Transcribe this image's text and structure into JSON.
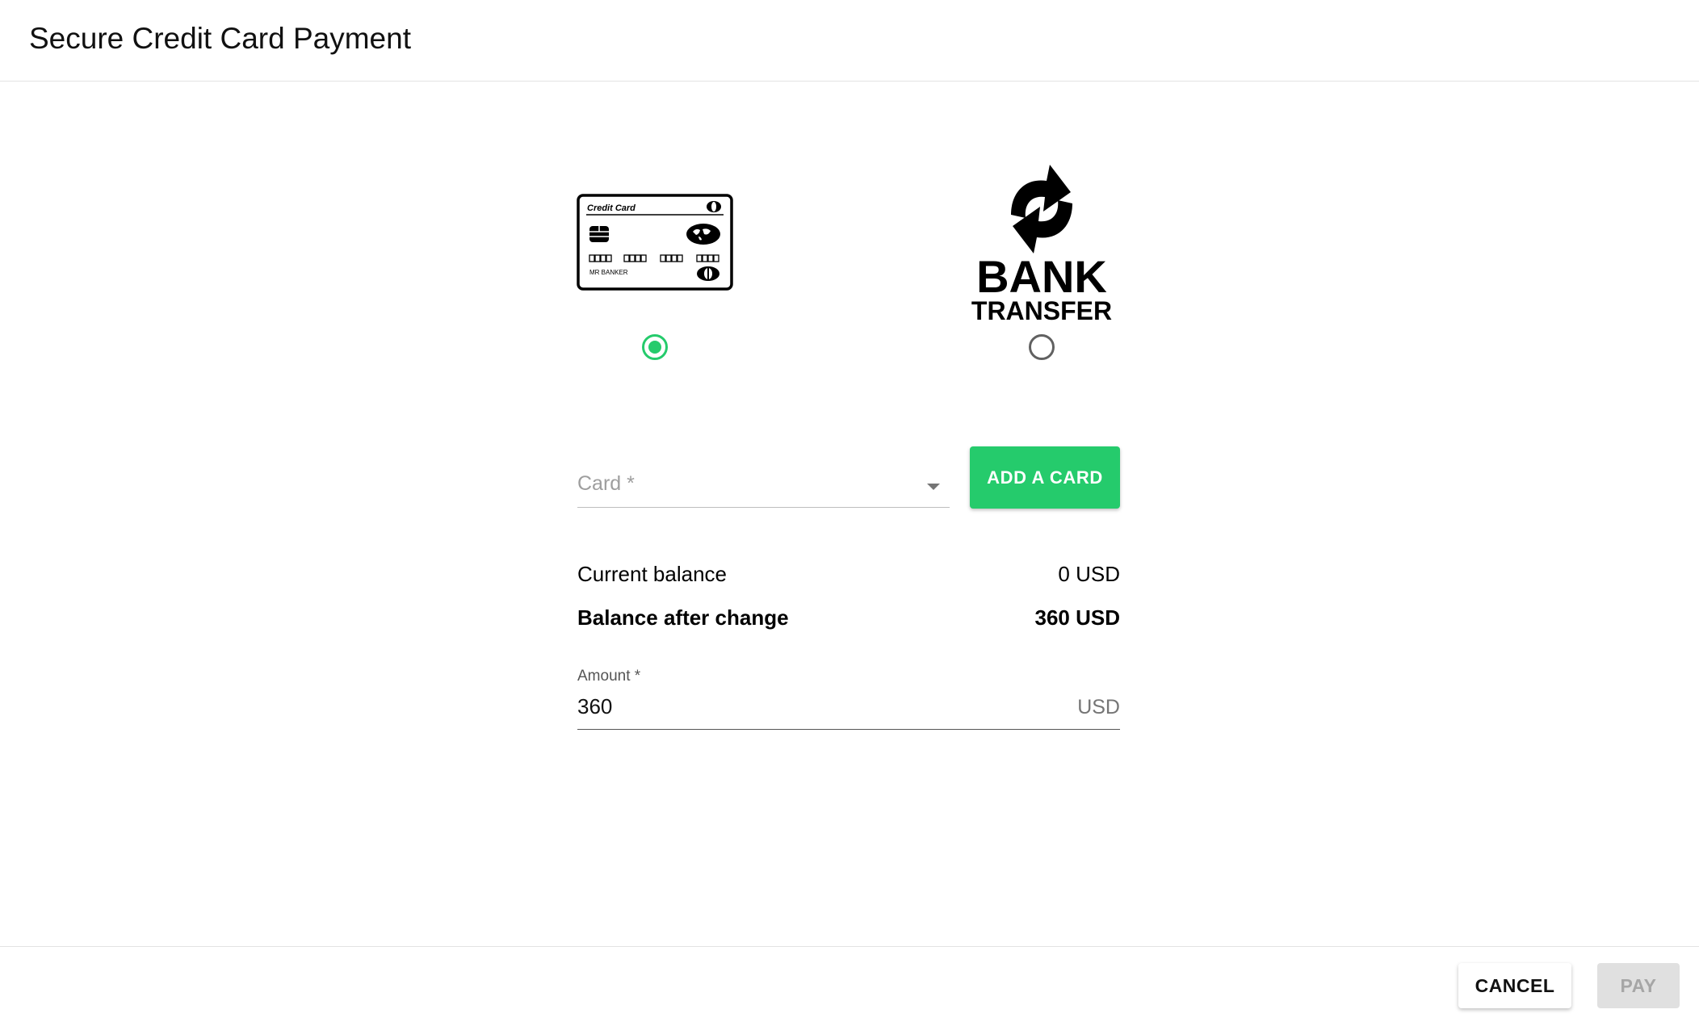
{
  "header": {
    "title": "Secure Credit Card Payment"
  },
  "payment_methods": {
    "selected": "credit_card",
    "credit_card": {
      "card_title": "Credit Card",
      "card_holder": "MR BANKER",
      "checked": true
    },
    "bank_transfer": {
      "line1": "BANK",
      "line2": "TRANSFER",
      "checked": false
    }
  },
  "card_select": {
    "placeholder": "Card *"
  },
  "add_card_button": "ADD A CARD",
  "balances": {
    "current_label": "Current balance",
    "current_value": "0 USD",
    "after_label": "Balance after change",
    "after_value": "360 USD"
  },
  "amount": {
    "label": "Amount *",
    "value": "360",
    "unit": "USD"
  },
  "footer": {
    "cancel_label": "CANCEL",
    "pay_label": "PAY",
    "pay_disabled": true
  },
  "colors": {
    "accent": "#25cb6c",
    "disabled_bg": "#e0e0e0",
    "disabled_text": "#a6a6a6"
  },
  "icons": {
    "credit_card": "credit-card-icon",
    "bank_transfer": "bank-transfer-logo",
    "dropdown": "chevron-down-icon"
  }
}
